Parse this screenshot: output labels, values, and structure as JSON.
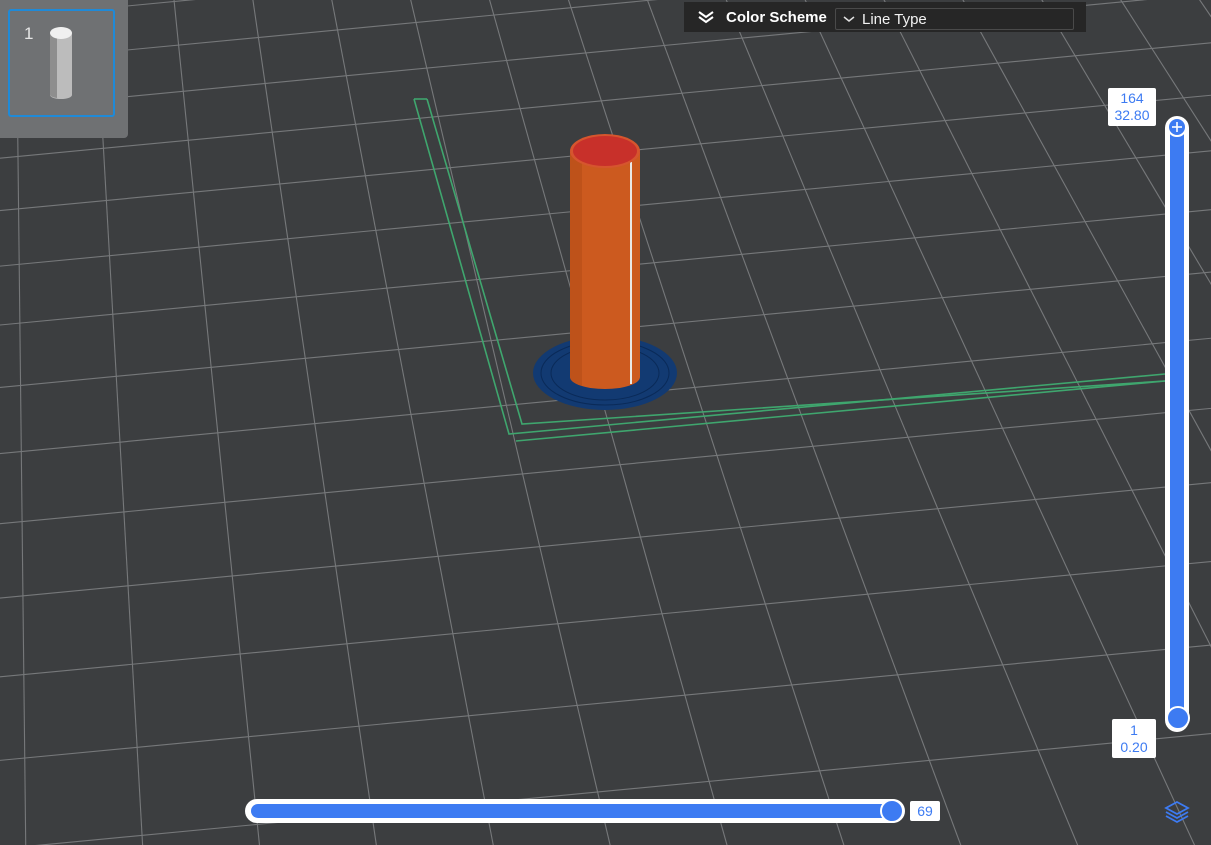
{
  "plate": {
    "number": "1"
  },
  "color_scheme": {
    "title": "Color Scheme",
    "selected": "Line Type"
  },
  "layer_slider": {
    "top_layer": "164",
    "top_height": "32.80",
    "bottom_layer": "1",
    "bottom_height": "0.20"
  },
  "move_slider": {
    "value": "69"
  },
  "colors": {
    "background": "#3c3e40",
    "grid": "#8a8c8e",
    "accent": "#3d7bf2",
    "bed_outline": "#3fa66e",
    "outer_wall": "#cc5a1f",
    "top_surface": "#c8302a",
    "brim": "#123a72"
  },
  "icons": [
    "collapse-chevrons-icon",
    "chevron-down-icon",
    "plus-icon",
    "layers-icon"
  ]
}
